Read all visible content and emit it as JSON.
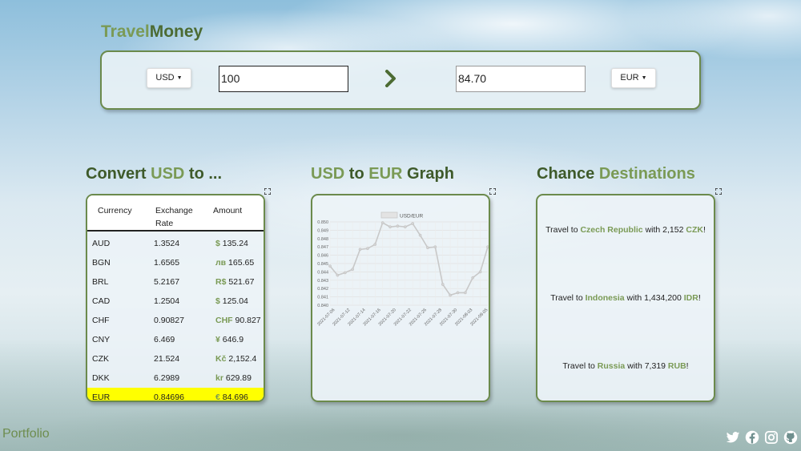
{
  "brand": {
    "part1": "Travel",
    "part2": "Money"
  },
  "converter": {
    "from_currency": "USD",
    "from_amount": "100",
    "to_currency": "EUR",
    "to_amount": "84.70"
  },
  "convert_section": {
    "title_prefix": "Convert ",
    "title_currency": "USD",
    "title_suffix": " to ...",
    "headers": [
      "Currency",
      "Exchange",
      "Rate",
      "Amount"
    ],
    "rows": [
      {
        "currency": "AUD",
        "rate": "1.3524",
        "symbol": "$",
        "amount": "135.24"
      },
      {
        "currency": "BGN",
        "rate": "1.6565",
        "symbol": "лв",
        "amount": "165.65"
      },
      {
        "currency": "BRL",
        "rate": "5.2167",
        "symbol": "R$",
        "amount": "521.67"
      },
      {
        "currency": "CAD",
        "rate": "1.2504",
        "symbol": "$",
        "amount": "125.04"
      },
      {
        "currency": "CHF",
        "rate": "0.90827",
        "symbol": "CHF",
        "amount": "90.827"
      },
      {
        "currency": "CNY",
        "rate": "6.469",
        "symbol": "¥",
        "amount": "646.9"
      },
      {
        "currency": "CZK",
        "rate": "21.524",
        "symbol": "Kč",
        "amount": "2,152.4"
      },
      {
        "currency": "DKK",
        "rate": "6.2989",
        "symbol": "kr",
        "amount": "629.89"
      },
      {
        "currency": "EUR",
        "rate": "0.84696",
        "symbol": "€",
        "amount": "84.696"
      }
    ]
  },
  "graph_section": {
    "title_from": "USD",
    "title_to_word": " to ",
    "title_to": "EUR",
    "title_suffix": " Graph"
  },
  "chart_data": {
    "type": "line",
    "legend": "USD/EUR",
    "x": [
      "2021-07-06",
      "2021-07-07",
      "2021-07-08",
      "2021-07-09",
      "2021-07-12",
      "2021-07-13",
      "2021-07-14",
      "2021-07-15",
      "2021-07-16",
      "2021-07-19",
      "2021-07-20",
      "2021-07-21",
      "2021-07-22",
      "2021-07-23",
      "2021-07-26",
      "2021-07-27",
      "2021-07-28",
      "2021-07-29",
      "2021-07-30",
      "2021-08-02",
      "2021-08-03",
      "2021-08-04",
      "2021-08-05",
      "2021-08-06"
    ],
    "values": [
      0.8447,
      0.8436,
      0.8439,
      0.8443,
      0.8467,
      0.8468,
      0.8473,
      0.8499,
      0.8494,
      0.8495,
      0.8494,
      0.8498,
      0.8484,
      0.8469,
      0.847,
      0.8425,
      0.8412,
      0.8415,
      0.8415,
      0.8433,
      0.844,
      0.847
    ],
    "x_tick_labels": [
      "2021-07-06",
      "2021-07-12",
      "2021-07-14",
      "2021-07-16",
      "2021-07-20",
      "2021-07-22",
      "2021-07-26",
      "2021-07-28",
      "2021-07-30",
      "2021-08-03",
      "2021-08-05"
    ],
    "y_ticks": [
      "0.850",
      "0.849",
      "0.848",
      "0.847",
      "0.846",
      "0.845",
      "0.844",
      "0.843",
      "0.842",
      "0.841",
      "0.840"
    ],
    "ylim": [
      0.84,
      0.85
    ],
    "grid": true,
    "legend_position": "top",
    "color": "#c8c8c8"
  },
  "destinations_section": {
    "title_word": "Chance",
    "title_hl": "Destinations",
    "items": [
      {
        "prefix": "Travel to ",
        "country": "Czech Republic",
        "middle": " with ",
        "amount": "2,152",
        "code": "CZK",
        "suffix": "!"
      },
      {
        "prefix": "Travel to ",
        "country": "Indonesia",
        "middle": " with ",
        "amount": "1,434,200",
        "code": "IDR",
        "suffix": "!"
      },
      {
        "prefix": "Travel to ",
        "country": "Russia",
        "middle": " with ",
        "amount": "7,319",
        "code": "RUB",
        "suffix": "!"
      }
    ]
  },
  "footer": {
    "portfolio_label": "Portfolio",
    "social_icons": [
      "twitter-icon",
      "facebook-icon",
      "instagram-icon",
      "github-icon"
    ]
  },
  "colors": {
    "accent_green": "#7a9a55",
    "dark_green": "#3e5a2a",
    "highlight": "#ffff00"
  }
}
